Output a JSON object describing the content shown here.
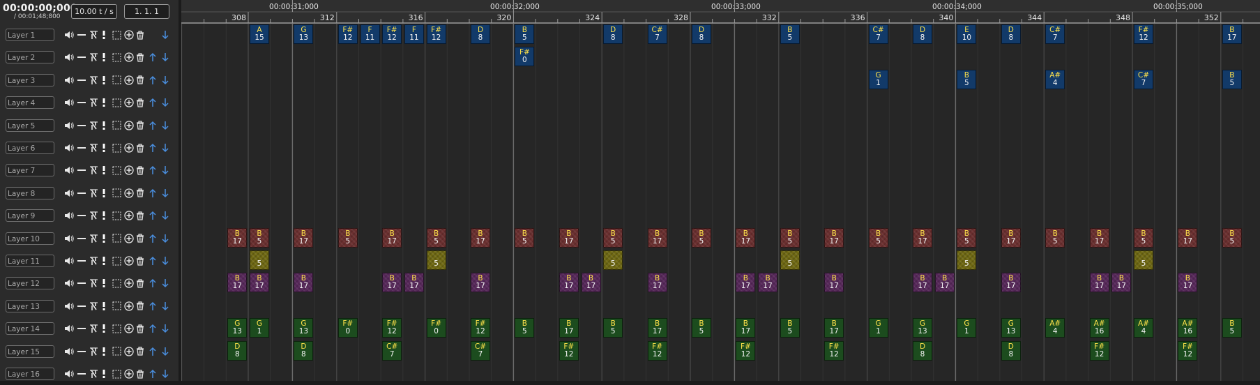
{
  "transport": {
    "current_time": "00:00:00;000",
    "total_time": "/ 00:01;48;800",
    "tempo": "10.00 t / s",
    "position": "1. 1. 1"
  },
  "layer_icons": [
    "speaker-icon",
    "solo-dash-icon",
    "lock-icon",
    "exclamation-icon",
    "select-box-icon",
    "add-icon",
    "delete-icon",
    "move-up-icon",
    "move-down-icon"
  ],
  "layers": [
    {
      "name": "Layer 1",
      "mute": false,
      "can_up": false,
      "can_down": true
    },
    {
      "name": "Layer 2",
      "mute": false,
      "can_up": true,
      "can_down": true
    },
    {
      "name": "Layer 3",
      "mute": false,
      "can_up": true,
      "can_down": true
    },
    {
      "name": "Layer 4",
      "mute": false,
      "can_up": true,
      "can_down": true
    },
    {
      "name": "Layer 5",
      "mute": false,
      "can_up": true,
      "can_down": true
    },
    {
      "name": "Layer 6",
      "mute": false,
      "can_up": true,
      "can_down": true
    },
    {
      "name": "Layer 7",
      "mute": false,
      "can_up": true,
      "can_down": true
    },
    {
      "name": "Layer 8",
      "mute": false,
      "can_up": true,
      "can_down": true
    },
    {
      "name": "Layer 9",
      "mute": false,
      "can_up": true,
      "can_down": true
    },
    {
      "name": "Layer 10",
      "mute": false,
      "can_up": true,
      "can_down": true
    },
    {
      "name": "Layer 11",
      "mute": false,
      "can_up": true,
      "can_down": true
    },
    {
      "name": "Layer 12",
      "mute": false,
      "can_up": true,
      "can_down": true
    },
    {
      "name": "Layer 13",
      "mute": false,
      "can_up": true,
      "can_down": true
    },
    {
      "name": "Layer 14",
      "mute": false,
      "can_up": true,
      "can_down": true
    },
    {
      "name": "Layer 15",
      "mute": false,
      "can_up": true,
      "can_down": true
    },
    {
      "name": "Layer 16",
      "mute": false,
      "can_up": true,
      "can_down": true
    }
  ],
  "ruler": {
    "first_tick": 306,
    "last_tick": 352,
    "labelled_ticks": [
      308,
      312,
      316,
      320,
      324,
      328,
      332,
      336,
      340,
      344,
      348,
      352
    ],
    "time_labels": [
      {
        "tick": 310,
        "text": "00:00:31;000"
      },
      {
        "tick": 320,
        "text": "00:00:32;000"
      },
      {
        "tick": 330,
        "text": "00:00:33;000"
      },
      {
        "tick": 340,
        "text": "00:00:34;000"
      },
      {
        "tick": 350,
        "text": "00:00:35;000"
      }
    ]
  },
  "colors": {
    "blue": "#123a69",
    "red": "#6a2f2f",
    "yellow": "#6f6812",
    "purple": "#57285a",
    "green": "#1c4c1e",
    "key_text": "#ffe24a"
  },
  "notes": [
    {
      "layer": 1,
      "tick": 308,
      "key": "A",
      "value": "15",
      "color": "blue"
    },
    {
      "layer": 1,
      "tick": 310,
      "key": "G",
      "value": "13",
      "color": "blue"
    },
    {
      "layer": 1,
      "tick": 312,
      "key": "F#",
      "value": "12",
      "color": "blue"
    },
    {
      "layer": 1,
      "tick": 313,
      "key": "F",
      "value": "11",
      "color": "blue"
    },
    {
      "layer": 1,
      "tick": 314,
      "key": "F#",
      "value": "12",
      "color": "blue"
    },
    {
      "layer": 1,
      "tick": 315,
      "key": "F",
      "value": "11",
      "color": "blue"
    },
    {
      "layer": 1,
      "tick": 316,
      "key": "F#",
      "value": "12",
      "color": "blue"
    },
    {
      "layer": 1,
      "tick": 318,
      "key": "D",
      "value": "8",
      "color": "blue"
    },
    {
      "layer": 1,
      "tick": 320,
      "key": "B",
      "value": "5",
      "color": "blue"
    },
    {
      "layer": 1,
      "tick": 324,
      "key": "D",
      "value": "8",
      "color": "blue"
    },
    {
      "layer": 1,
      "tick": 326,
      "key": "C#",
      "value": "7",
      "color": "blue"
    },
    {
      "layer": 1,
      "tick": 328,
      "key": "D",
      "value": "8",
      "color": "blue"
    },
    {
      "layer": 1,
      "tick": 332,
      "key": "B",
      "value": "5",
      "color": "blue"
    },
    {
      "layer": 1,
      "tick": 336,
      "key": "C#",
      "value": "7",
      "color": "blue"
    },
    {
      "layer": 1,
      "tick": 338,
      "key": "D",
      "value": "8",
      "color": "blue"
    },
    {
      "layer": 1,
      "tick": 340,
      "key": "E",
      "value": "10",
      "color": "blue"
    },
    {
      "layer": 1,
      "tick": 342,
      "key": "D",
      "value": "8",
      "color": "blue"
    },
    {
      "layer": 1,
      "tick": 344,
      "key": "C#",
      "value": "7",
      "color": "blue"
    },
    {
      "layer": 1,
      "tick": 348,
      "key": "F#",
      "value": "12",
      "color": "blue"
    },
    {
      "layer": 1,
      "tick": 352,
      "key": "B",
      "value": "17",
      "color": "blue"
    },
    {
      "layer": 2,
      "tick": 320,
      "key": "F#",
      "value": "0",
      "color": "blue"
    },
    {
      "layer": 3,
      "tick": 336,
      "key": "G",
      "value": "1",
      "color": "blue"
    },
    {
      "layer": 3,
      "tick": 340,
      "key": "B",
      "value": "5",
      "color": "blue"
    },
    {
      "layer": 3,
      "tick": 344,
      "key": "A#",
      "value": "4",
      "color": "blue"
    },
    {
      "layer": 3,
      "tick": 348,
      "key": "C#",
      "value": "7",
      "color": "blue"
    },
    {
      "layer": 3,
      "tick": 352,
      "key": "B",
      "value": "5",
      "color": "blue"
    },
    {
      "layer": 10,
      "tick": 307,
      "key": "B",
      "value": "17",
      "color": "red"
    },
    {
      "layer": 10,
      "tick": 308,
      "key": "B",
      "value": "5",
      "color": "red"
    },
    {
      "layer": 10,
      "tick": 310,
      "key": "B",
      "value": "17",
      "color": "red"
    },
    {
      "layer": 10,
      "tick": 312,
      "key": "B",
      "value": "5",
      "color": "red"
    },
    {
      "layer": 10,
      "tick": 314,
      "key": "B",
      "value": "17",
      "color": "red"
    },
    {
      "layer": 10,
      "tick": 316,
      "key": "B",
      "value": "5",
      "color": "red"
    },
    {
      "layer": 10,
      "tick": 318,
      "key": "B",
      "value": "17",
      "color": "red"
    },
    {
      "layer": 10,
      "tick": 320,
      "key": "B",
      "value": "5",
      "color": "red"
    },
    {
      "layer": 10,
      "tick": 322,
      "key": "B",
      "value": "17",
      "color": "red"
    },
    {
      "layer": 10,
      "tick": 324,
      "key": "B",
      "value": "5",
      "color": "red"
    },
    {
      "layer": 10,
      "tick": 326,
      "key": "B",
      "value": "17",
      "color": "red"
    },
    {
      "layer": 10,
      "tick": 328,
      "key": "B",
      "value": "5",
      "color": "red"
    },
    {
      "layer": 10,
      "tick": 330,
      "key": "B",
      "value": "17",
      "color": "red"
    },
    {
      "layer": 10,
      "tick": 332,
      "key": "B",
      "value": "5",
      "color": "red"
    },
    {
      "layer": 10,
      "tick": 334,
      "key": "B",
      "value": "17",
      "color": "red"
    },
    {
      "layer": 10,
      "tick": 336,
      "key": "B",
      "value": "5",
      "color": "red"
    },
    {
      "layer": 10,
      "tick": 338,
      "key": "B",
      "value": "17",
      "color": "red"
    },
    {
      "layer": 10,
      "tick": 340,
      "key": "B",
      "value": "5",
      "color": "red"
    },
    {
      "layer": 10,
      "tick": 342,
      "key": "B",
      "value": "17",
      "color": "red"
    },
    {
      "layer": 10,
      "tick": 344,
      "key": "B",
      "value": "5",
      "color": "red"
    },
    {
      "layer": 10,
      "tick": 346,
      "key": "B",
      "value": "17",
      "color": "red"
    },
    {
      "layer": 10,
      "tick": 348,
      "key": "B",
      "value": "5",
      "color": "red"
    },
    {
      "layer": 10,
      "tick": 350,
      "key": "B",
      "value": "17",
      "color": "red"
    },
    {
      "layer": 10,
      "tick": 352,
      "key": "B",
      "value": "5",
      "color": "red"
    },
    {
      "layer": 11,
      "tick": 308,
      "key": "",
      "value": "5",
      "color": "yellow"
    },
    {
      "layer": 11,
      "tick": 316,
      "key": "",
      "value": "5",
      "color": "yellow"
    },
    {
      "layer": 11,
      "tick": 324,
      "key": "",
      "value": "5",
      "color": "yellow"
    },
    {
      "layer": 11,
      "tick": 332,
      "key": "",
      "value": "5",
      "color": "yellow"
    },
    {
      "layer": 11,
      "tick": 340,
      "key": "",
      "value": "5",
      "color": "yellow"
    },
    {
      "layer": 11,
      "tick": 348,
      "key": "",
      "value": "5",
      "color": "yellow"
    },
    {
      "layer": 12,
      "tick": 307,
      "key": "B",
      "value": "17",
      "color": "purple"
    },
    {
      "layer": 12,
      "tick": 308,
      "key": "B",
      "value": "17",
      "color": "purple"
    },
    {
      "layer": 12,
      "tick": 310,
      "key": "B",
      "value": "17",
      "color": "purple"
    },
    {
      "layer": 12,
      "tick": 314,
      "key": "B",
      "value": "17",
      "color": "purple"
    },
    {
      "layer": 12,
      "tick": 315,
      "key": "B",
      "value": "17",
      "color": "purple"
    },
    {
      "layer": 12,
      "tick": 318,
      "key": "B",
      "value": "17",
      "color": "purple"
    },
    {
      "layer": 12,
      "tick": 322,
      "key": "B",
      "value": "17",
      "color": "purple"
    },
    {
      "layer": 12,
      "tick": 323,
      "key": "B",
      "value": "17",
      "color": "purple"
    },
    {
      "layer": 12,
      "tick": 326,
      "key": "B",
      "value": "17",
      "color": "purple"
    },
    {
      "layer": 12,
      "tick": 330,
      "key": "B",
      "value": "17",
      "color": "purple"
    },
    {
      "layer": 12,
      "tick": 331,
      "key": "B",
      "value": "17",
      "color": "purple"
    },
    {
      "layer": 12,
      "tick": 334,
      "key": "B",
      "value": "17",
      "color": "purple"
    },
    {
      "layer": 12,
      "tick": 338,
      "key": "B",
      "value": "17",
      "color": "purple"
    },
    {
      "layer": 12,
      "tick": 339,
      "key": "B",
      "value": "17",
      "color": "purple"
    },
    {
      "layer": 12,
      "tick": 342,
      "key": "B",
      "value": "17",
      "color": "purple"
    },
    {
      "layer": 12,
      "tick": 346,
      "key": "B",
      "value": "17",
      "color": "purple"
    },
    {
      "layer": 12,
      "tick": 347,
      "key": "B",
      "value": "17",
      "color": "purple"
    },
    {
      "layer": 12,
      "tick": 350,
      "key": "B",
      "value": "17",
      "color": "purple"
    },
    {
      "layer": 14,
      "tick": 307,
      "key": "G",
      "value": "13",
      "color": "green"
    },
    {
      "layer": 14,
      "tick": 308,
      "key": "G",
      "value": "1",
      "color": "green"
    },
    {
      "layer": 14,
      "tick": 310,
      "key": "G",
      "value": "13",
      "color": "green"
    },
    {
      "layer": 14,
      "tick": 312,
      "key": "F#",
      "value": "0",
      "color": "green"
    },
    {
      "layer": 14,
      "tick": 314,
      "key": "F#",
      "value": "12",
      "color": "green"
    },
    {
      "layer": 14,
      "tick": 316,
      "key": "F#",
      "value": "0",
      "color": "green"
    },
    {
      "layer": 14,
      "tick": 318,
      "key": "F#",
      "value": "12",
      "color": "green"
    },
    {
      "layer": 14,
      "tick": 320,
      "key": "B",
      "value": "5",
      "color": "green"
    },
    {
      "layer": 14,
      "tick": 322,
      "key": "B",
      "value": "17",
      "color": "green"
    },
    {
      "layer": 14,
      "tick": 324,
      "key": "B",
      "value": "5",
      "color": "green"
    },
    {
      "layer": 14,
      "tick": 326,
      "key": "B",
      "value": "17",
      "color": "green"
    },
    {
      "layer": 14,
      "tick": 328,
      "key": "B",
      "value": "5",
      "color": "green"
    },
    {
      "layer": 14,
      "tick": 330,
      "key": "B",
      "value": "17",
      "color": "green"
    },
    {
      "layer": 14,
      "tick": 332,
      "key": "B",
      "value": "5",
      "color": "green"
    },
    {
      "layer": 14,
      "tick": 334,
      "key": "B",
      "value": "17",
      "color": "green"
    },
    {
      "layer": 14,
      "tick": 336,
      "key": "G",
      "value": "1",
      "color": "green"
    },
    {
      "layer": 14,
      "tick": 338,
      "key": "G",
      "value": "13",
      "color": "green"
    },
    {
      "layer": 14,
      "tick": 340,
      "key": "G",
      "value": "1",
      "color": "green"
    },
    {
      "layer": 14,
      "tick": 342,
      "key": "G",
      "value": "13",
      "color": "green"
    },
    {
      "layer": 14,
      "tick": 344,
      "key": "A#",
      "value": "4",
      "color": "green"
    },
    {
      "layer": 14,
      "tick": 346,
      "key": "A#",
      "value": "16",
      "color": "green"
    },
    {
      "layer": 14,
      "tick": 348,
      "key": "A#",
      "value": "4",
      "color": "green"
    },
    {
      "layer": 14,
      "tick": 350,
      "key": "A#",
      "value": "16",
      "color": "green"
    },
    {
      "layer": 14,
      "tick": 352,
      "key": "B",
      "value": "5",
      "color": "green"
    },
    {
      "layer": 15,
      "tick": 307,
      "key": "D",
      "value": "8",
      "color": "green"
    },
    {
      "layer": 15,
      "tick": 310,
      "key": "D",
      "value": "8",
      "color": "green"
    },
    {
      "layer": 15,
      "tick": 314,
      "key": "C#",
      "value": "7",
      "color": "green"
    },
    {
      "layer": 15,
      "tick": 318,
      "key": "C#",
      "value": "7",
      "color": "green"
    },
    {
      "layer": 15,
      "tick": 322,
      "key": "F#",
      "value": "12",
      "color": "green"
    },
    {
      "layer": 15,
      "tick": 326,
      "key": "F#",
      "value": "12",
      "color": "green"
    },
    {
      "layer": 15,
      "tick": 330,
      "key": "F#",
      "value": "12",
      "color": "green"
    },
    {
      "layer": 15,
      "tick": 334,
      "key": "F#",
      "value": "12",
      "color": "green"
    },
    {
      "layer": 15,
      "tick": 338,
      "key": "D",
      "value": "8",
      "color": "green"
    },
    {
      "layer": 15,
      "tick": 342,
      "key": "D",
      "value": "8",
      "color": "green"
    },
    {
      "layer": 15,
      "tick": 346,
      "key": "F#",
      "value": "12",
      "color": "green"
    },
    {
      "layer": 15,
      "tick": 350,
      "key": "F#",
      "value": "12",
      "color": "green"
    }
  ]
}
